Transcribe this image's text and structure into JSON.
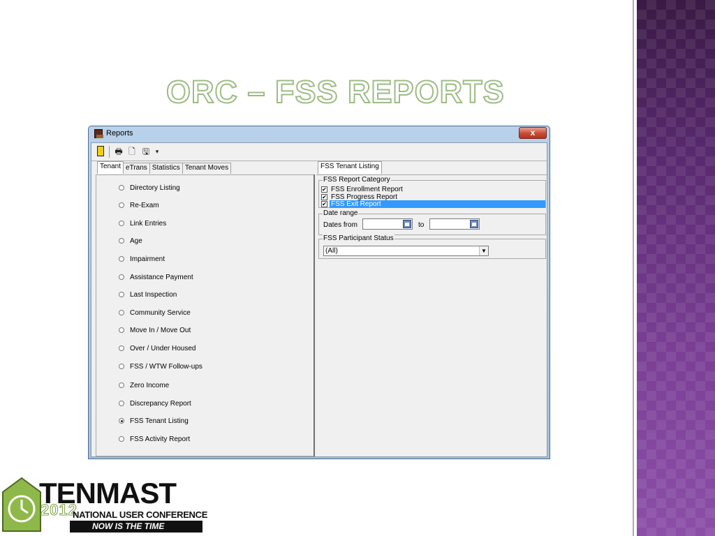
{
  "slide": {
    "title": "ORC – FSS REPORTS"
  },
  "window": {
    "title": "Reports",
    "close_label": "x"
  },
  "toolbar": {
    "dropdown_glyph": "▾"
  },
  "left_tabs": [
    {
      "label": "Tenant",
      "active": true
    },
    {
      "label": "eTrans",
      "active": false
    },
    {
      "label": "Statistics",
      "active": false
    },
    {
      "label": "Tenant Moves",
      "active": false
    }
  ],
  "report_options": [
    {
      "label": "Directory Listing",
      "selected": false
    },
    {
      "label": "Re-Exam",
      "selected": false
    },
    {
      "label": "Link Entries",
      "selected": false
    },
    {
      "label": "Age",
      "selected": false
    },
    {
      "label": "Impairment",
      "selected": false
    },
    {
      "label": "Assistance Payment",
      "selected": false
    },
    {
      "label": "Last Inspection",
      "selected": false
    },
    {
      "label": "Community Service",
      "selected": false
    },
    {
      "label": "Move In / Move Out",
      "selected": false
    },
    {
      "label": "Over / Under Housed",
      "selected": false
    },
    {
      "label": "FSS / WTW Follow-ups",
      "selected": false
    },
    {
      "label": "Zero Income",
      "selected": false
    },
    {
      "label": "Discrepancy Report",
      "selected": false
    },
    {
      "label": "FSS Tenant Listing",
      "selected": true
    },
    {
      "label": "FSS Activity Report",
      "selected": false
    }
  ],
  "right_panel": {
    "tab_label": "FSS Tenant Listing",
    "category_group": {
      "legend": "FSS Report Category",
      "items": [
        {
          "label": "FSS Enrollment Report",
          "checked": true,
          "highlighted": false
        },
        {
          "label": "FSS Progress Report",
          "checked": true,
          "highlighted": false
        },
        {
          "label": "FSS Exit Report",
          "checked": true,
          "highlighted": true
        }
      ]
    },
    "date_group": {
      "legend": "Date range",
      "from_label": "Dates from",
      "to_label": "to",
      "from_value": "",
      "to_value": ""
    },
    "status_group": {
      "legend": "FSS Participant Status",
      "selected_value": "(All)"
    }
  },
  "logo": {
    "name": "TENMAST",
    "year": "2012",
    "conference": "NATIONAL USER CONFERENCE",
    "tagline": "NOW IS THE TIME"
  }
}
